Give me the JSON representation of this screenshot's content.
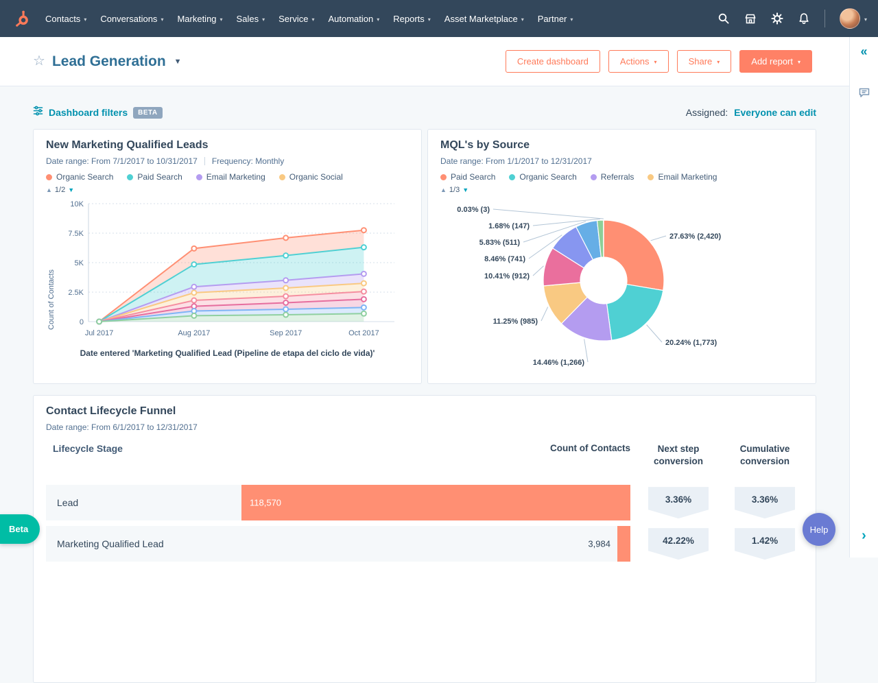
{
  "nav": {
    "items": [
      {
        "label": "Contacts"
      },
      {
        "label": "Conversations"
      },
      {
        "label": "Marketing"
      },
      {
        "label": "Sales"
      },
      {
        "label": "Service"
      },
      {
        "label": "Automation"
      },
      {
        "label": "Reports"
      },
      {
        "label": "Asset Marketplace"
      },
      {
        "label": "Partner"
      }
    ]
  },
  "header": {
    "title": "Lead Generation",
    "buttons": {
      "create": "Create dashboard",
      "actions": "Actions",
      "share": "Share",
      "add_report": "Add report"
    }
  },
  "filters": {
    "label": "Dashboard filters",
    "beta": "BETA",
    "assigned_label": "Assigned:",
    "assigned_value": "Everyone can edit"
  },
  "beta_pill": "Beta",
  "help_label": "Help",
  "colors": {
    "nav_bg": "#33475b",
    "accent": "#ff7a59",
    "link": "#0091ae",
    "heading": "#33475b",
    "funnel_bar": "#ff8f73"
  },
  "chart_data": [
    {
      "type": "area",
      "title": "New Marketing Qualified Leads",
      "date_range": "Date range: From 7/1/2017 to 10/31/2017",
      "frequency": "Frequency: Monthly",
      "pagination": "1/2",
      "ylabel": "Count of Contacts",
      "ylim": [
        0,
        10000
      ],
      "yticks": [
        {
          "label": "10K",
          "value": 10000
        },
        {
          "label": "7.5K",
          "value": 7500
        },
        {
          "label": "5K",
          "value": 5000
        },
        {
          "label": "2.5K",
          "value": 2500
        },
        {
          "label": "0",
          "value": 0
        }
      ],
      "categories": [
        "Jul 2017",
        "Aug 2017",
        "Sep 2017",
        "Oct 2017"
      ],
      "legend": [
        {
          "label": "Organic Search",
          "color": "#ff8f73"
        },
        {
          "label": "Paid Search",
          "color": "#4fd0d3"
        },
        {
          "label": "Email Marketing",
          "color": "#b49cf0"
        },
        {
          "label": "Organic Social",
          "color": "#f9c982"
        }
      ],
      "series": [
        {
          "name": "Organic Search",
          "color": "#ff8f73",
          "values": [
            0,
            6200,
            7100,
            7750
          ]
        },
        {
          "name": "Paid Search",
          "color": "#4fd0d3",
          "values": [
            0,
            4850,
            5600,
            6300
          ]
        },
        {
          "name": "Email Marketing",
          "color": "#b49cf0",
          "values": [
            0,
            2950,
            3500,
            4050
          ]
        },
        {
          "name": "Organic Social",
          "color": "#f9c982",
          "values": [
            0,
            2450,
            2850,
            3250
          ]
        },
        {
          "name": "",
          "color": "#f58ea0",
          "values": [
            0,
            1800,
            2150,
            2550
          ]
        },
        {
          "name": "",
          "color": "#e66e9e",
          "values": [
            0,
            1300,
            1600,
            1900
          ]
        },
        {
          "name": "",
          "color": "#7fb5f5",
          "values": [
            0,
            900,
            1050,
            1200
          ]
        },
        {
          "name": "",
          "color": "#8fd0a0",
          "values": [
            0,
            500,
            580,
            680
          ]
        }
      ],
      "caption": "Date entered 'Marketing Qualified Lead (Pipeline de etapa del ciclo de vida)'"
    },
    {
      "type": "pie",
      "title": "MQL's by Source",
      "date_range": "Date range: From 1/1/2017 to 12/31/2017",
      "pagination": "1/3",
      "legend": [
        {
          "label": "Paid Search",
          "color": "#ff8f73"
        },
        {
          "label": "Organic Search",
          "color": "#4fd0d3"
        },
        {
          "label": "Referrals",
          "color": "#b49cf0"
        },
        {
          "label": "Email Marketing",
          "color": "#f9c982"
        }
      ],
      "slices": [
        {
          "label": "27.63% (2,420)",
          "pct": 27.63,
          "count": 2420,
          "color": "#ff8f73"
        },
        {
          "label": "20.24% (1,773)",
          "pct": 20.24,
          "count": 1773,
          "color": "#4fd0d3"
        },
        {
          "label": "14.46% (1,266)",
          "pct": 14.46,
          "count": 1266,
          "color": "#b49cf0"
        },
        {
          "label": "11.25% (985)",
          "pct": 11.25,
          "count": 985,
          "color": "#f9c982"
        },
        {
          "label": "10.41% (912)",
          "pct": 10.41,
          "count": 912,
          "color": "#ea6f9d"
        },
        {
          "label": "8.46% (741)",
          "pct": 8.46,
          "count": 741,
          "color": "#8796f0"
        },
        {
          "label": "5.83% (511)",
          "pct": 5.83,
          "count": 511,
          "color": "#66aee6"
        },
        {
          "label": "1.68% (147)",
          "pct": 1.68,
          "count": 147,
          "color": "#8ccf97"
        },
        {
          "label": "0.03% (3)",
          "pct": 0.03,
          "count": 3,
          "color": "#a83a50"
        }
      ]
    },
    {
      "type": "funnel",
      "title": "Contact Lifecycle Funnel",
      "date_range": "Date range: From 6/1/2017 to 12/31/2017",
      "columns": {
        "stage": "Lifecycle Stage",
        "count": "Count of Contacts",
        "next": "Next step conversion",
        "cumulative": "Cumulative conversion"
      },
      "rows": [
        {
          "stage": "Lead",
          "count_label": "118,570",
          "count": 118570,
          "next": "3.36%",
          "cumulative": "3.36%"
        },
        {
          "stage": "Marketing Qualified Lead",
          "count_label": "3,984",
          "count": 3984,
          "next": "42.22%",
          "cumulative": "1.42%"
        }
      ]
    }
  ]
}
